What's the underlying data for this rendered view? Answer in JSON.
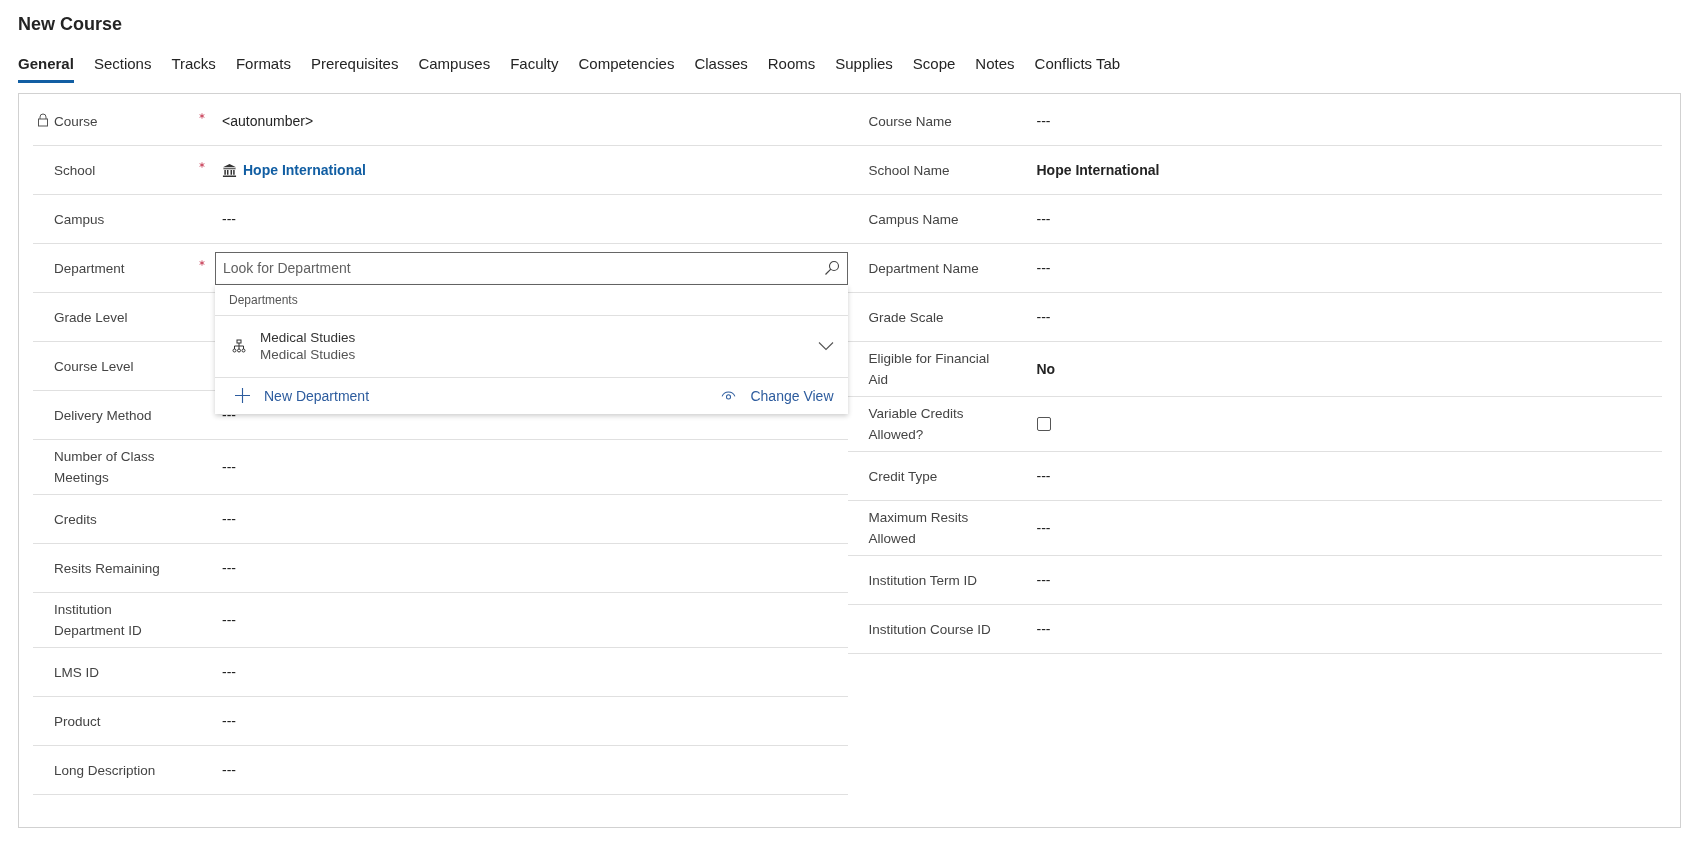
{
  "title": "New Course",
  "tabs": [
    {
      "label": "General",
      "selected": true
    },
    {
      "label": "Sections",
      "selected": false
    },
    {
      "label": "Tracks",
      "selected": false
    },
    {
      "label": "Formats",
      "selected": false
    },
    {
      "label": "Prerequisites",
      "selected": false
    },
    {
      "label": "Campuses",
      "selected": false
    },
    {
      "label": "Faculty",
      "selected": false
    },
    {
      "label": "Competencies",
      "selected": false
    },
    {
      "label": "Classes",
      "selected": false
    },
    {
      "label": "Rooms",
      "selected": false
    },
    {
      "label": "Supplies",
      "selected": false
    },
    {
      "label": "Scope",
      "selected": false
    },
    {
      "label": "Notes",
      "selected": false
    },
    {
      "label": "Conflicts Tab",
      "selected": false
    }
  ],
  "left_fields": [
    {
      "label": "Course",
      "required": true,
      "locked": true,
      "kind": "text",
      "value": "<autonumber>"
    },
    {
      "label": "School",
      "required": true,
      "locked": false,
      "kind": "lookup",
      "value": "Hope International"
    },
    {
      "label": "Campus",
      "required": false,
      "locked": false,
      "kind": "text",
      "value": "---"
    },
    {
      "label": "Department",
      "required": true,
      "locked": false,
      "kind": "search",
      "placeholder": "Look for Department",
      "dropdown": {
        "header": "Departments",
        "results": [
          {
            "title": "Medical Studies",
            "subtitle": "Medical Studies"
          }
        ],
        "new_label": "New Department",
        "view_label": "Change View"
      }
    },
    {
      "label": "Grade Level",
      "required": false,
      "locked": false,
      "kind": "text"
    },
    {
      "label": "Course Level",
      "required": false,
      "locked": false,
      "kind": "text"
    },
    {
      "label": "Delivery Method",
      "required": false,
      "locked": false,
      "kind": "text",
      "value": "---"
    },
    {
      "label": "Number of Class Meetings",
      "required": false,
      "locked": false,
      "kind": "text",
      "value": "---"
    },
    {
      "label": "Credits",
      "required": false,
      "locked": false,
      "kind": "text",
      "value": "---"
    },
    {
      "label": "Resits Remaining",
      "required": false,
      "locked": false,
      "kind": "text",
      "value": "---"
    },
    {
      "label": "Institution Department ID",
      "required": false,
      "locked": false,
      "kind": "text",
      "value": "---"
    },
    {
      "label": "LMS ID",
      "required": false,
      "locked": false,
      "kind": "text",
      "value": "---"
    },
    {
      "label": "Product",
      "required": false,
      "locked": false,
      "kind": "text",
      "value": "---"
    },
    {
      "label": "Long Description",
      "required": false,
      "locked": false,
      "kind": "text",
      "value": "---"
    }
  ],
  "right_fields": [
    {
      "label": "Course Name",
      "kind": "text",
      "value": "---"
    },
    {
      "label": "School Name",
      "kind": "strong",
      "value": "Hope International"
    },
    {
      "label": "Campus Name",
      "kind": "text",
      "value": "---"
    },
    {
      "label": "Department Name",
      "kind": "text",
      "value": "---"
    },
    {
      "label": "Grade Scale",
      "kind": "text",
      "value": "---"
    },
    {
      "label": "Eligible for Financial Aid",
      "kind": "strong",
      "value": "No"
    },
    {
      "label": "Variable Credits Allowed?",
      "kind": "checkbox",
      "checked": false
    },
    {
      "label": "Credit Type",
      "kind": "text",
      "value": "---"
    },
    {
      "label": "Maximum Resits Allowed",
      "kind": "text",
      "value": "---"
    },
    {
      "label": "Institution Term ID",
      "kind": "text",
      "value": "---"
    },
    {
      "label": "Institution Course ID",
      "kind": "text",
      "value": "---"
    }
  ]
}
